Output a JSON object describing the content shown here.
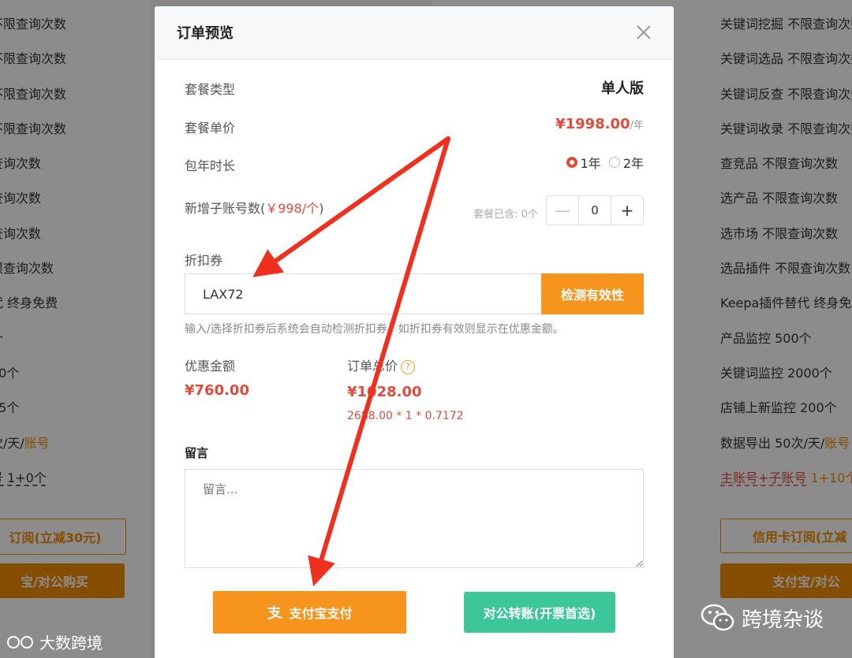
{
  "background": {
    "left_features": [
      "不限查询次数",
      "不限查询次数",
      "不限查询次数",
      "不限查询次数",
      "查询次数",
      "查询次数",
      "查询次数",
      "限查询次数",
      "代 终身免费",
      "个",
      "50个",
      " 25个"
    ],
    "left_daily_prefix": "次/天/",
    "left_daily_suffix": "账号",
    "left_acct": "号 1+0个",
    "left_btn_subscribe": "订阅(立减30元)",
    "left_btn_alipay": "宝/对公购买",
    "right_features": [
      "关键词挖掘 不限查询次数",
      "关键词选品 不限查询次数",
      "关键词反查 不限查询次数",
      "关键词收录 不限查询次数",
      "查竞品 不限查询次数",
      "选产品 不限查询次数",
      "选市场 不限查询次数",
      "选品插件 不限查询次数",
      "Keepa插件替代 终身免费",
      "产品监控 500个",
      "关键词监控 2000个",
      "店铺上新监控 200个"
    ],
    "right_daily_prefix": "数据导出 50次/天/",
    "right_daily_suffix": "账号",
    "right_acct_link": "主账号+子账号",
    "right_acct_count": " 1+10个",
    "right_btn_subscribe": "信用卡订阅(立减",
    "right_btn_alipay": "支付宝/对公"
  },
  "modal": {
    "title": "订单预览",
    "plan_type_label": "套餐类型",
    "plan_type_value": "单人版",
    "unit_price_label": "套餐单价",
    "unit_price_value": "¥1998.00",
    "unit_price_unit": "/年",
    "duration_label": "包年时长",
    "duration_options": [
      "1年",
      "2年"
    ],
    "duration_selected": "1年",
    "sub_accounts_label": "新增子账号数(",
    "sub_accounts_price": "￥998/个",
    "sub_accounts_close": ")",
    "included_text": "套餐已含: 0个",
    "sub_accounts_value": "0",
    "minus_label": "—",
    "plus_label": "+",
    "coupon_label": "折扣券",
    "coupon_value": "LAX72",
    "check_button": "检测有效性",
    "coupon_hint": "输入/选择折扣券后系统会自动检测折扣券，如折扣券有效则显示在优惠金额。",
    "discount_label": "优惠金额",
    "discount_value": "¥760.00",
    "total_label": "订单总价",
    "total_value": "¥1028.00",
    "total_formula": "2688.00 * 1 * 0.7172",
    "message_label": "留言",
    "message_placeholder": "留言...",
    "alipay_button": "支付宝支付",
    "transfer_button": "对公转账(开票首选)"
  },
  "watermarks": {
    "left": "大数跨境",
    "right": "跨境杂谈"
  },
  "colors": {
    "accent_orange": "#f7941d",
    "price_red": "#e04b3a",
    "transfer_green": "#3cc69a",
    "arrow_red": "#f0301e"
  }
}
